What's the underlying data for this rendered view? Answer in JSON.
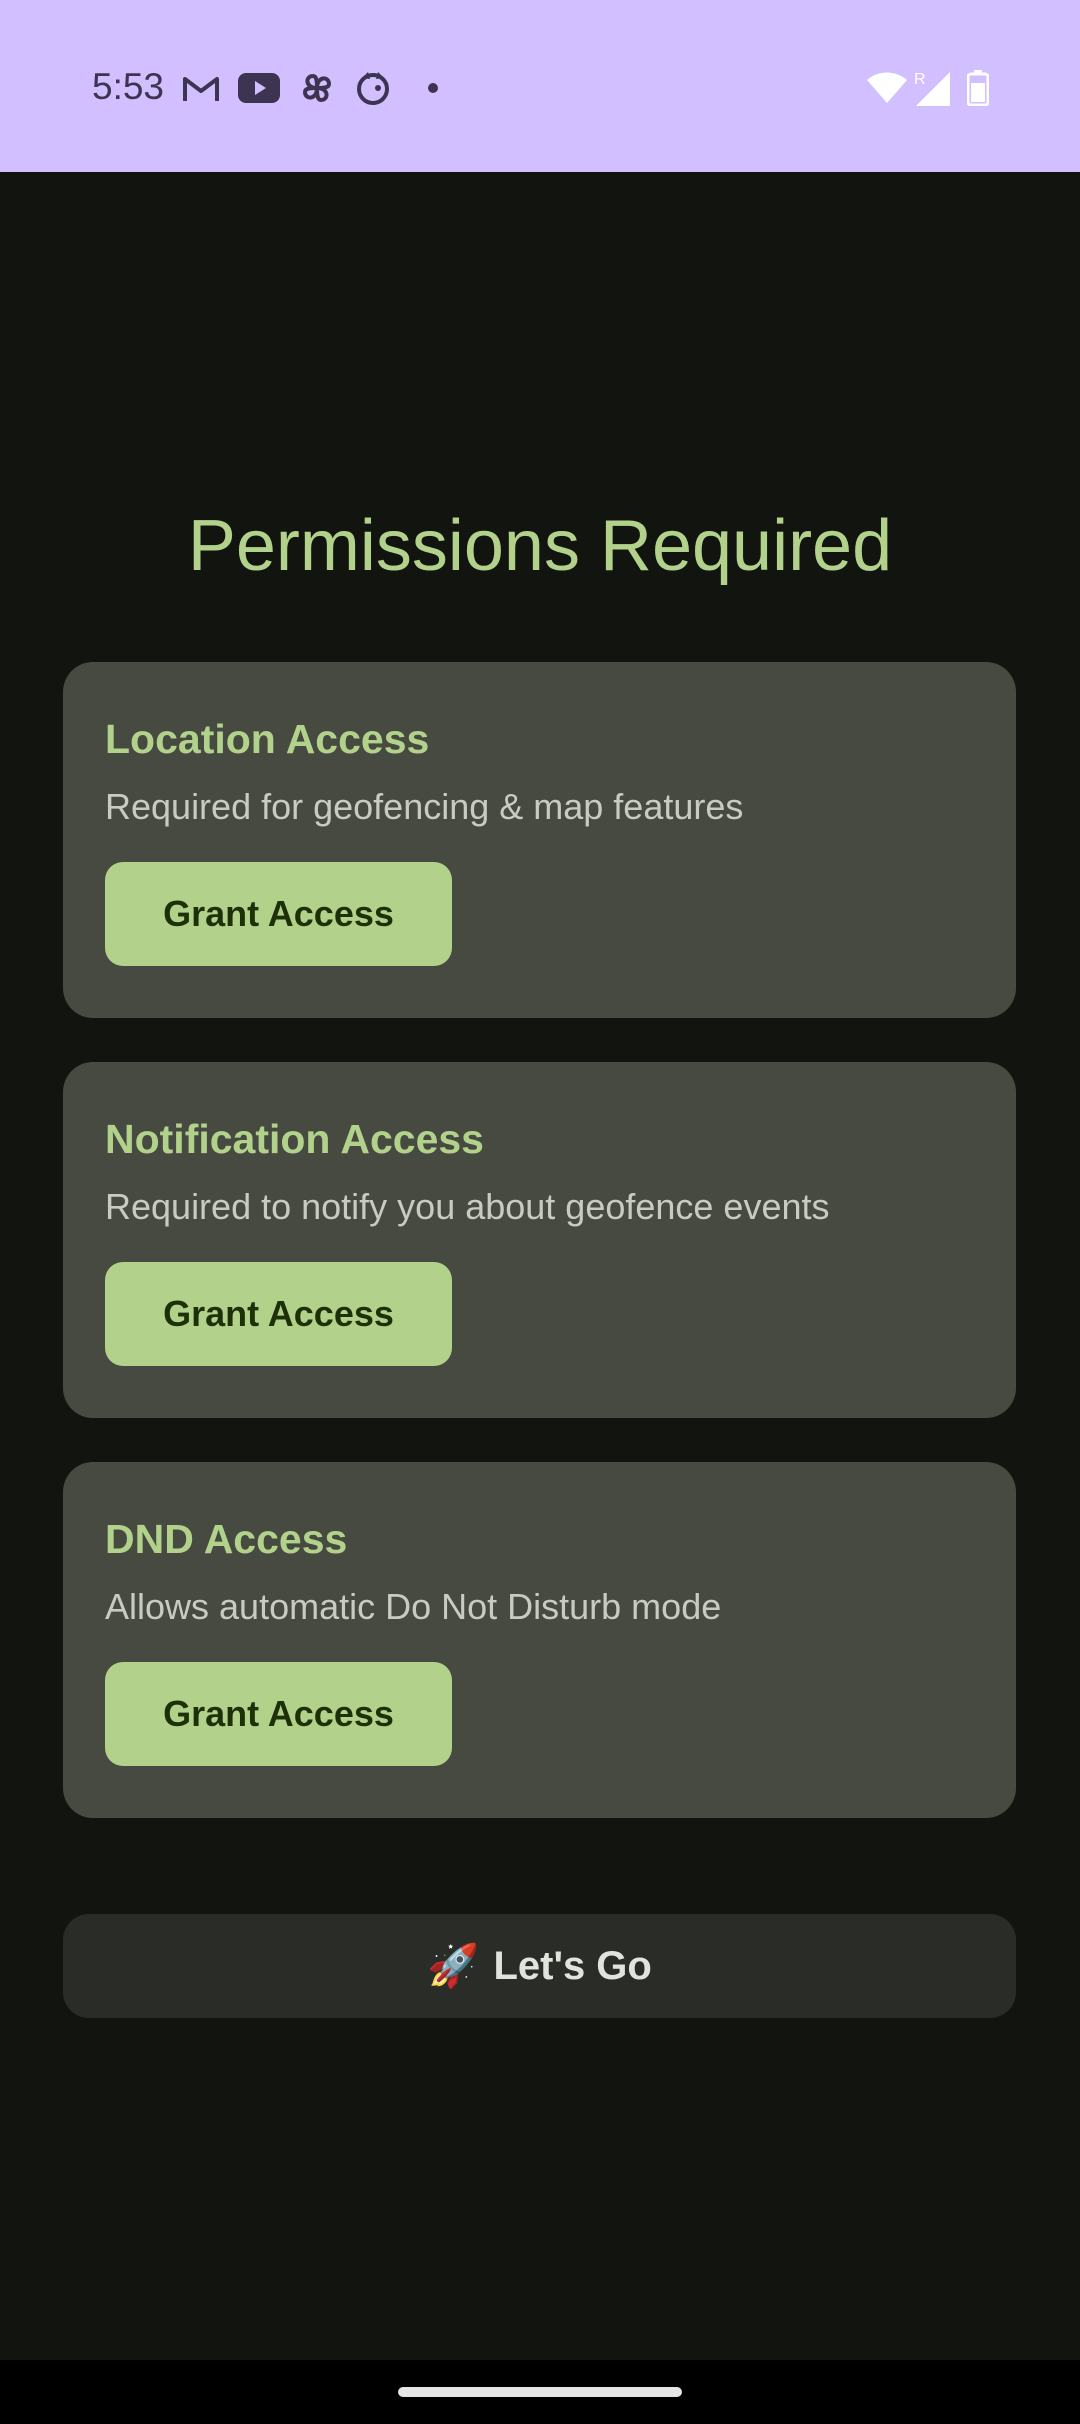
{
  "status_bar": {
    "time": "5:53",
    "left_icons": [
      "gmail-icon",
      "youtube-icon",
      "pinwheel-icon",
      "dog-app-icon",
      "dot-icon"
    ],
    "right_icons": [
      "wifi-icon",
      "signal-roaming-icon",
      "battery-icon"
    ],
    "roaming_label": "R"
  },
  "page": {
    "title": "Permissions Required"
  },
  "cards": [
    {
      "title": "Location Access",
      "description": "Required for geofencing & map features",
      "button_label": "Grant Access"
    },
    {
      "title": "Notification Access",
      "description": "Required to notify you about geofence events",
      "button_label": "Grant Access"
    },
    {
      "title": "DND Access",
      "description": "Allows automatic Do Not Disturb mode",
      "button_label": "Grant Access"
    }
  ],
  "go_button": {
    "emoji": "🚀",
    "label": "Let's Go"
  },
  "colors": {
    "status_bar_bg": "#d1bfff",
    "background": "#121410",
    "card_bg": "#464a41",
    "accent": "#b2d28b",
    "go_button_bg": "#2a2c27"
  }
}
